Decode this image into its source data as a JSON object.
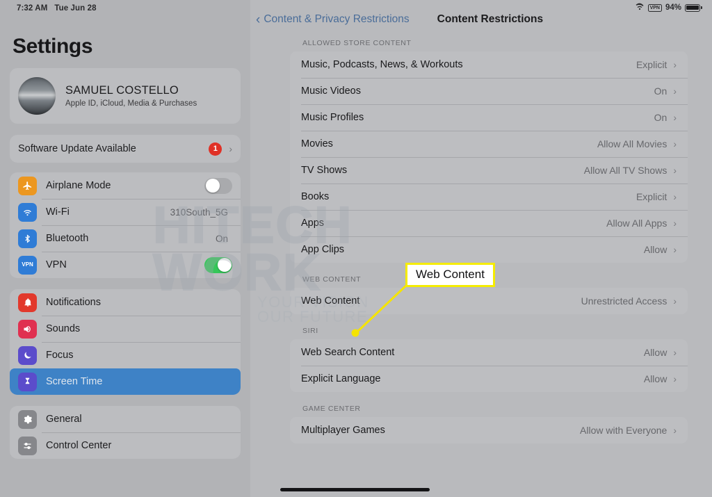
{
  "status_bar": {
    "time": "7:32 AM",
    "date": "Tue Jun 28",
    "wifi_icon": "wifi-icon",
    "vpn_badge": "VPN",
    "battery_percent": "94%",
    "battery_icon": "battery-icon"
  },
  "sidebar": {
    "title": "Settings",
    "profile": {
      "name": "SAMUEL COSTELLO",
      "subtitle": "Apple ID, iCloud, Media & Purchases",
      "avatar_icon": "avatar"
    },
    "update": {
      "label": "Software Update Available",
      "badge": "1",
      "chevron": "›"
    },
    "groups": [
      {
        "items": [
          {
            "label": "Airplane Mode",
            "icon": "airplane-icon",
            "icon_color": "#ec9720",
            "control": "toggle",
            "toggle_state": "off",
            "value": ""
          },
          {
            "label": "Wi-Fi",
            "icon": "wifi-icon",
            "icon_color": "#2f7cd6",
            "control": "value",
            "value": "310South_5G"
          },
          {
            "label": "Bluetooth",
            "icon": "bluetooth-icon",
            "icon_color": "#2f7cd6",
            "control": "value",
            "value": "On"
          },
          {
            "label": "VPN",
            "icon": "vpn-icon",
            "icon_color": "#2f7cd6",
            "control": "toggle",
            "toggle_state": "on",
            "value": ""
          }
        ]
      },
      {
        "items": [
          {
            "label": "Notifications",
            "icon": "bell-icon",
            "icon_color": "#e2392c",
            "control": "none",
            "value": ""
          },
          {
            "label": "Sounds",
            "icon": "speaker-icon",
            "icon_color": "#e03050",
            "control": "none",
            "value": ""
          },
          {
            "label": "Focus",
            "icon": "moon-icon",
            "icon_color": "#5b4ccb",
            "control": "none",
            "value": ""
          },
          {
            "label": "Screen Time",
            "icon": "hourglass-icon",
            "icon_color": "#5b4ccb",
            "control": "none",
            "value": "",
            "selected": true
          }
        ]
      },
      {
        "items": [
          {
            "label": "General",
            "icon": "gear-icon",
            "icon_color": "#86878b",
            "control": "none",
            "value": ""
          },
          {
            "label": "Control Center",
            "icon": "control-center-icon",
            "icon_color": "#86878b",
            "control": "none",
            "value": ""
          }
        ]
      }
    ]
  },
  "detail": {
    "back_label": "Content & Privacy Restrictions",
    "back_chevron": "‹",
    "title": "Content Restrictions",
    "sections": [
      {
        "header": "ALLOWED STORE CONTENT",
        "rows": [
          {
            "label": "Music, Podcasts, News, & Workouts",
            "value": "Explicit",
            "chevron": "›"
          },
          {
            "label": "Music Videos",
            "value": "On",
            "chevron": "›"
          },
          {
            "label": "Music Profiles",
            "value": "On",
            "chevron": "›"
          },
          {
            "label": "Movies",
            "value": "Allow All Movies",
            "chevron": "›"
          },
          {
            "label": "TV Shows",
            "value": "Allow All TV Shows",
            "chevron": "›"
          },
          {
            "label": "Books",
            "value": "Explicit",
            "chevron": "›"
          },
          {
            "label": "Apps",
            "value": "Allow All Apps",
            "chevron": "›"
          },
          {
            "label": "App Clips",
            "value": "Allow",
            "chevron": "›"
          }
        ]
      },
      {
        "header": "WEB CONTENT",
        "rows": [
          {
            "label": "Web Content",
            "value": "Unrestricted Access",
            "chevron": "›"
          }
        ]
      },
      {
        "header": "SIRI",
        "rows": [
          {
            "label": "Web Search Content",
            "value": "Allow",
            "chevron": "›"
          },
          {
            "label": "Explicit Language",
            "value": "Allow",
            "chevron": "›"
          }
        ]
      },
      {
        "header": "GAME CENTER",
        "rows": [
          {
            "label": "Multiplayer Games",
            "value": "Allow with Everyone",
            "chevron": "›"
          }
        ]
      }
    ]
  },
  "annotation": {
    "callout_label": "Web Content",
    "callout_border_color": "#f5ec00",
    "pointer_color": "#f5e400"
  },
  "watermark": {
    "line1": "HITECH",
    "line2": "WORK",
    "tagline1": "YOUR VISION",
    "tagline2": "OUR FUTURE"
  }
}
